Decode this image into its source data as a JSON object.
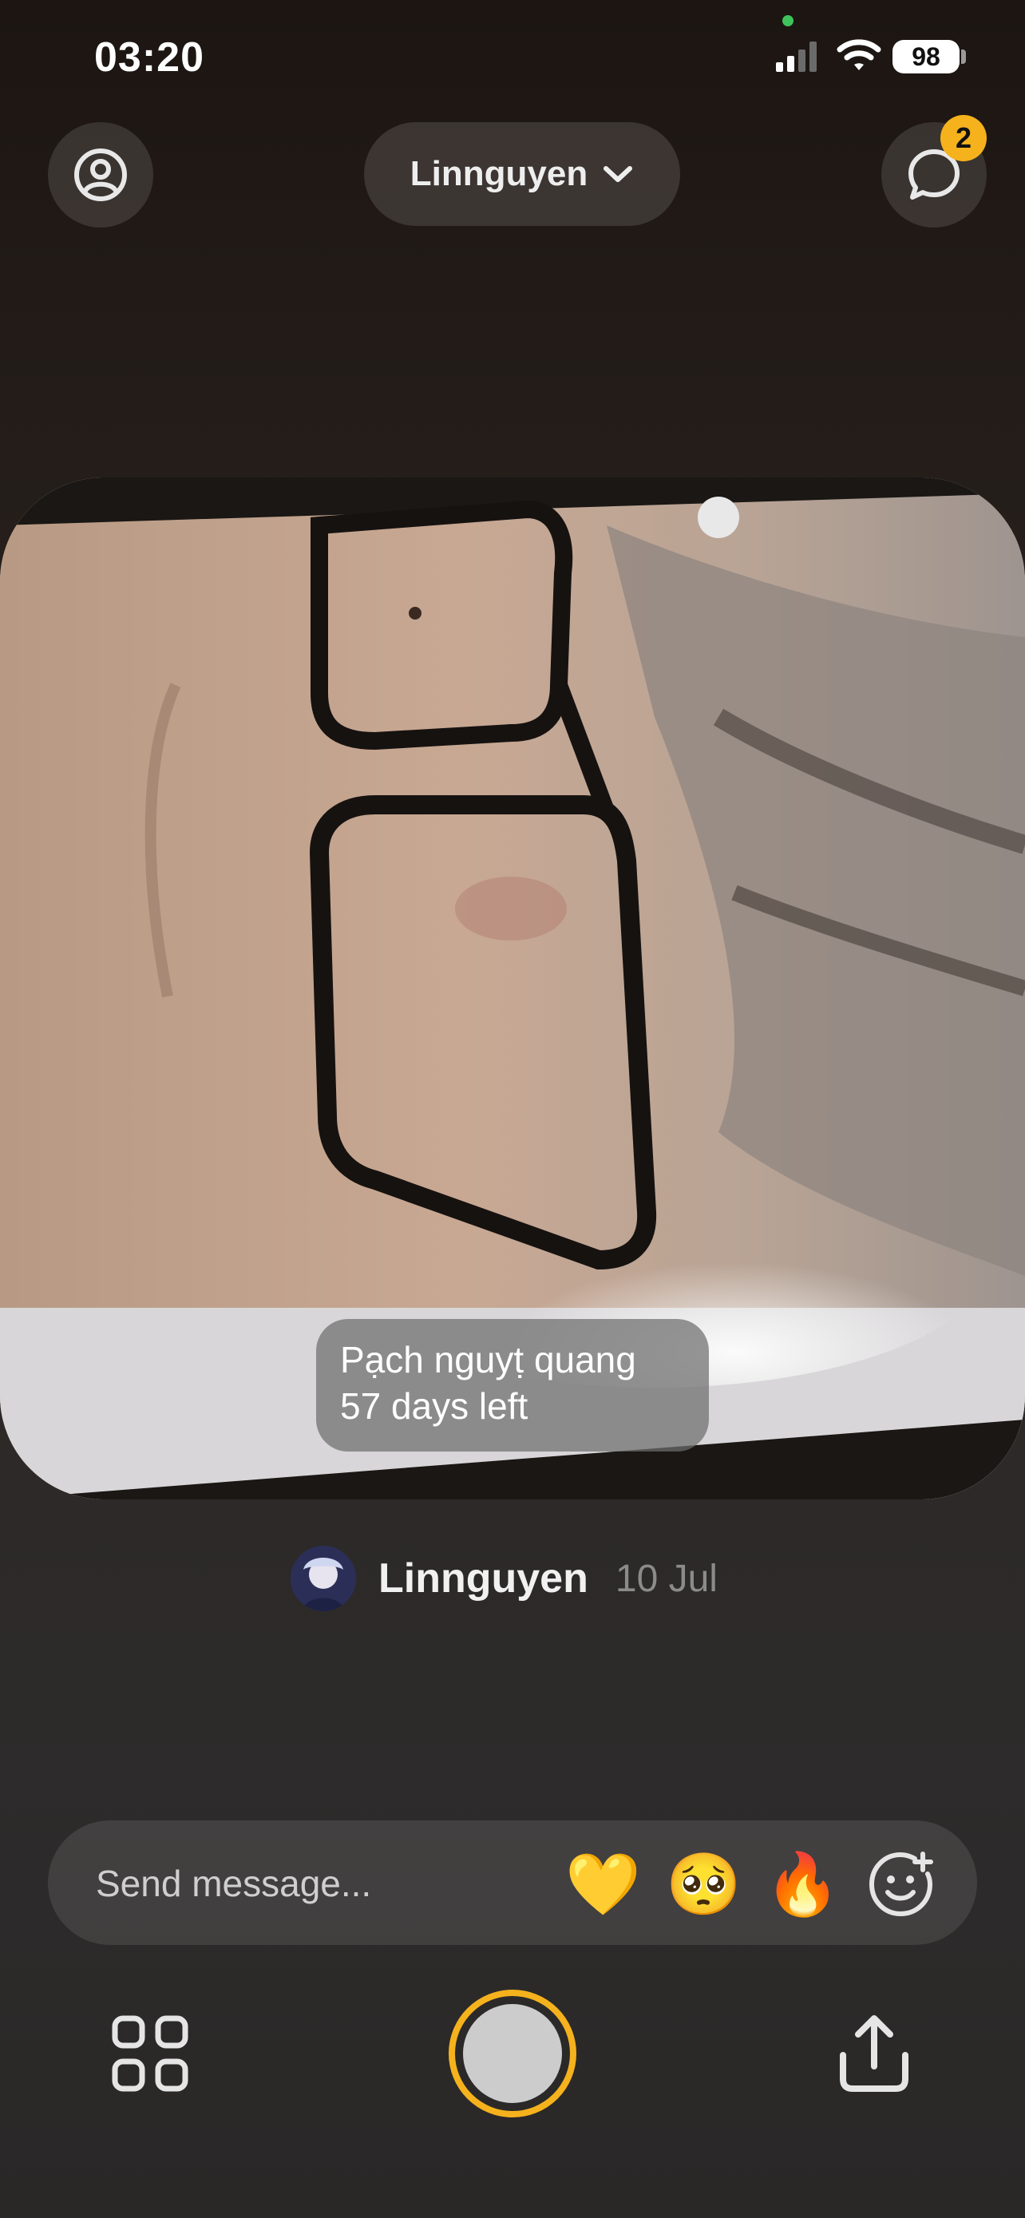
{
  "status_bar": {
    "time": "03:20",
    "battery": "98"
  },
  "top_bar": {
    "friend_selector": "Linnguyen",
    "chat_badge": "2"
  },
  "post": {
    "caption_line1": "Pạch nguyṭ quang",
    "caption_line2": "57 days left",
    "author": "Linnguyen",
    "date": "10 Jul"
  },
  "message_bar": {
    "placeholder": "Send message...",
    "reactions": [
      "💛",
      "🥺",
      "🔥"
    ]
  },
  "icons": {
    "profile": "person-circle-icon",
    "chat": "chat-bubble-icon",
    "grid": "grid-icon",
    "share": "share-icon",
    "add_reaction": "add-emoji-icon"
  },
  "colors": {
    "accent": "#f5b21d",
    "badge_text": "#111111"
  }
}
